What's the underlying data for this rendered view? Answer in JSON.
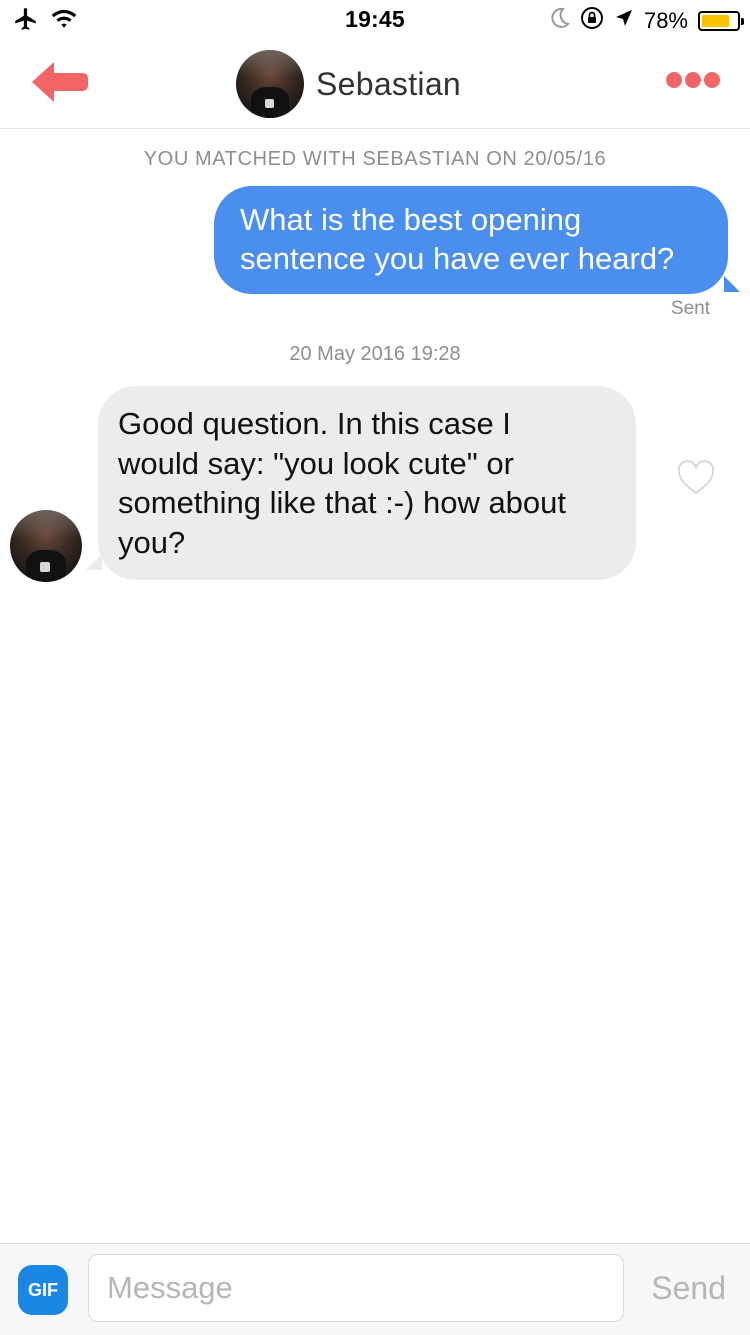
{
  "status_bar": {
    "time": "19:45",
    "battery_percent": "78%",
    "battery_level": 0.78,
    "icons": [
      "airplane-icon",
      "wifi-icon",
      "moon-icon",
      "orientation-lock-icon",
      "location-icon",
      "battery-icon"
    ]
  },
  "header": {
    "name": "Sebastian",
    "back_icon": "back-arrow-icon",
    "more_icon": "more-dots-icon",
    "accent_color": "#f36466"
  },
  "conversation": {
    "match_banner": "YOU MATCHED WITH SEBASTIAN ON 20/05/16",
    "outgoing": {
      "lines": [
        "What is the best opening",
        "sentence you have ever heard?"
      ],
      "status": "Sent",
      "color": "#4a8ef0"
    },
    "timestamp": "20 May 2016 19:28",
    "incoming": {
      "lines": [
        "Good question. In this case I",
        "would say: \"you look cute\" or",
        "something like that :-) how about",
        "you?"
      ],
      "color": "#ececec",
      "like_icon": "heart-outline-icon"
    }
  },
  "input_bar": {
    "gif_label": "GIF",
    "placeholder": "Message",
    "send_label": "Send"
  }
}
